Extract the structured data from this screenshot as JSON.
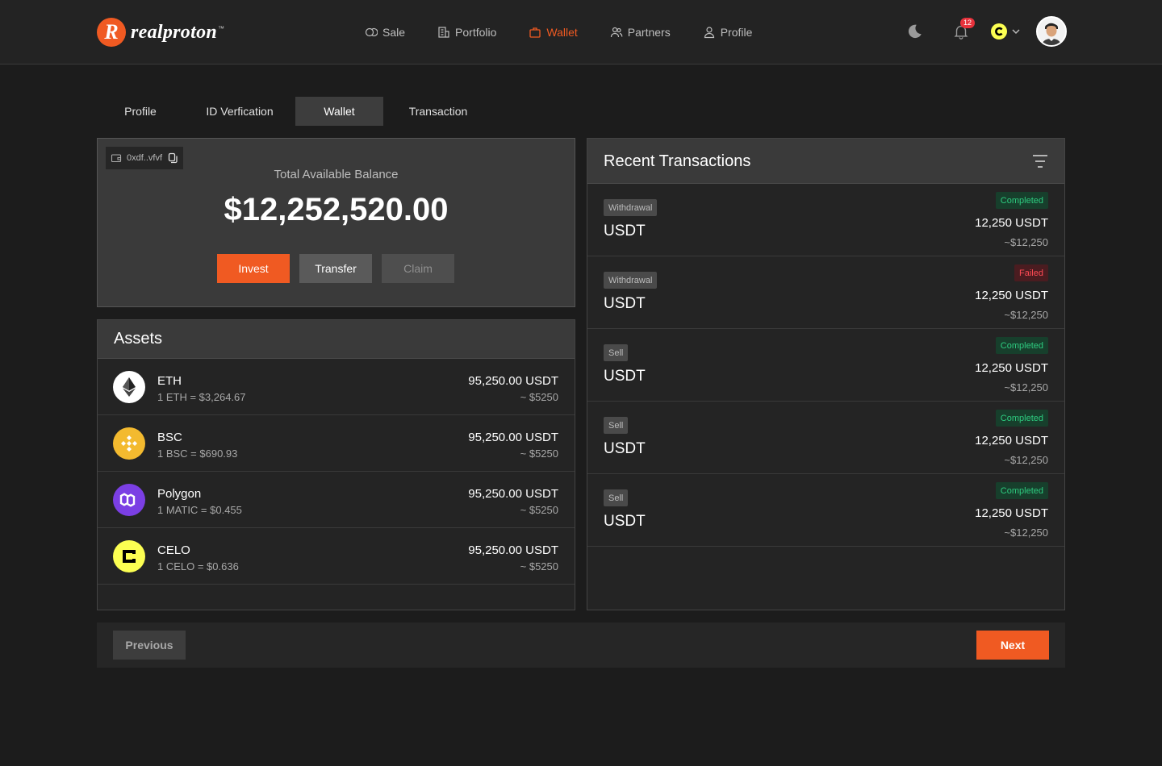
{
  "brand": {
    "logo_letter": "R",
    "name": "realproton",
    "tm": "™",
    "accent": "#f05a22"
  },
  "nav": [
    {
      "label": "Sale",
      "icon": "coins-icon"
    },
    {
      "label": "Portfolio",
      "icon": "building-icon"
    },
    {
      "label": "Wallet",
      "icon": "briefcase-icon",
      "active": true
    },
    {
      "label": "Partners",
      "icon": "users-icon"
    },
    {
      "label": "Profile",
      "icon": "user-icon"
    }
  ],
  "header": {
    "notification_count": "12"
  },
  "tabs": [
    {
      "label": "Profile"
    },
    {
      "label": "ID Verfication"
    },
    {
      "label": "Wallet",
      "active": true
    },
    {
      "label": "Transaction"
    }
  ],
  "balance": {
    "wallet_address": "0xdf..vfvf",
    "label": "Total Available Balance",
    "value": "$12,252,520.00",
    "invest_label": "Invest",
    "transfer_label": "Transfer",
    "claim_label": "Claim"
  },
  "assets": {
    "title": "Assets",
    "items": [
      {
        "name": "ETH",
        "rate": "1 ETH = $3,264.67",
        "amount": "95,250.00 USDT",
        "usd": "~ $5250",
        "icon": "eth-icon",
        "color": "#ffffff"
      },
      {
        "name": "BSC",
        "rate": "1 BSC = $690.93",
        "amount": "95,250.00 USDT",
        "usd": "~ $5250",
        "icon": "bnb-icon",
        "color": "#f3ba2f"
      },
      {
        "name": "Polygon",
        "rate": "1 MATIC = $0.455",
        "amount": "95,250.00 USDT",
        "usd": "~ $5250",
        "icon": "polygon-icon",
        "color": "#7b3fe4"
      },
      {
        "name": "CELO",
        "rate": "1 CELO = $0.636",
        "amount": "95,250.00 USDT",
        "usd": "~ $5250",
        "icon": "celo-icon",
        "color": "#fcff52"
      }
    ]
  },
  "transactions": {
    "title": "Recent Transactions",
    "items": [
      {
        "type": "Withdrawal",
        "asset": "USDT",
        "status": "Completed",
        "amount": "12,250 USDT",
        "usd": "~$12,250"
      },
      {
        "type": "Withdrawal",
        "asset": "USDT",
        "status": "Failed",
        "amount": "12,250 USDT",
        "usd": "~$12,250"
      },
      {
        "type": "Sell",
        "asset": "USDT",
        "status": "Completed",
        "amount": "12,250 USDT",
        "usd": "~$12,250"
      },
      {
        "type": "Sell",
        "asset": "USDT",
        "status": "Completed",
        "amount": "12,250 USDT",
        "usd": "~$12,250"
      },
      {
        "type": "Sell",
        "asset": "USDT",
        "status": "Completed",
        "amount": "12,250 USDT",
        "usd": "~$12,250"
      }
    ]
  },
  "footer": {
    "previous_label": "Previous",
    "next_label": "Next"
  }
}
